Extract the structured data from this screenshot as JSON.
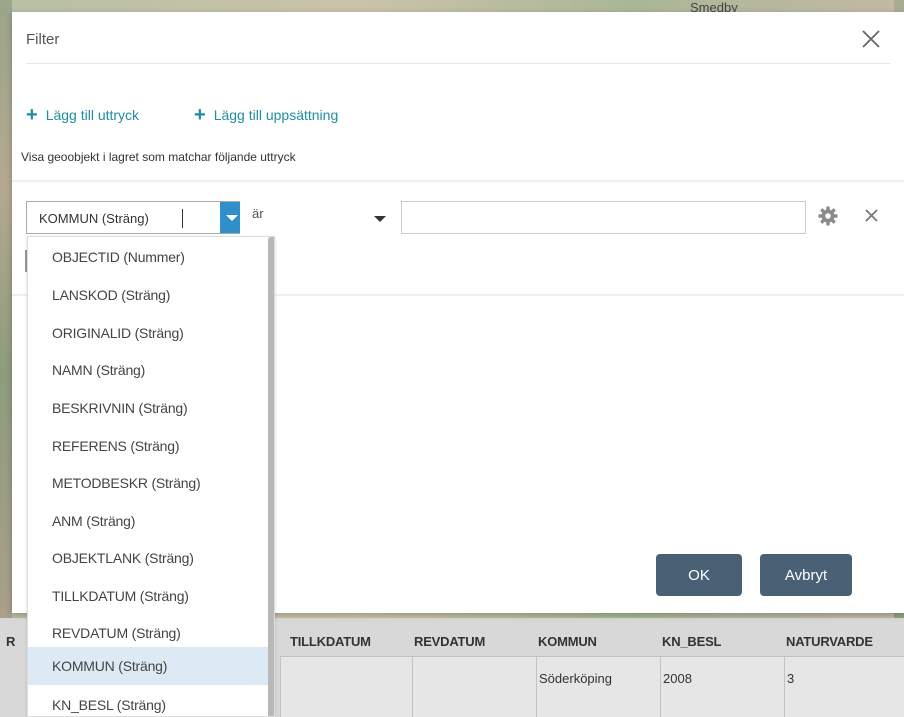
{
  "map": {
    "label": "Smedby"
  },
  "dialog": {
    "title": "Filter",
    "add_expression": "Lägg till uttryck",
    "add_set": "Lägg till uppsättning",
    "description": "Visa geoobjekt i lagret som matchar följande uttryck",
    "field_value": "KOMMUN (Sträng)",
    "operator_value": "är",
    "value_input": "",
    "ok_label": "OK",
    "cancel_label": "Avbryt"
  },
  "dropdown": {
    "items": [
      "OBJECTID (Nummer)",
      "LANSKOD (Sträng)",
      "ORIGINALID (Sträng)",
      "NAMN (Sträng)",
      "BESKRIVNIN (Sträng)",
      "REFERENS (Sträng)",
      "METODBESKR (Sträng)",
      "ANM (Sträng)",
      "OBJEKTLANK (Sträng)",
      "TILLKDATUM (Sträng)",
      "REVDATUM (Sträng)",
      "KOMMUN (Sträng)",
      "KN_BESL (Sträng)"
    ],
    "selected": "KOMMUN (Sträng)"
  },
  "table": {
    "headers": [
      "R",
      "TILLKDATUM",
      "REVDATUM",
      "KOMMUN",
      "KN_BESL",
      "NATURVARDE"
    ],
    "row": [
      "",
      "",
      "Söderköping",
      "2008",
      "3"
    ]
  },
  "colors": {
    "accent": "#1f8ea3",
    "dropdown_button": "#2f8fc9",
    "button_bg": "#4a6175",
    "selected_item": "#ddeaf6"
  }
}
